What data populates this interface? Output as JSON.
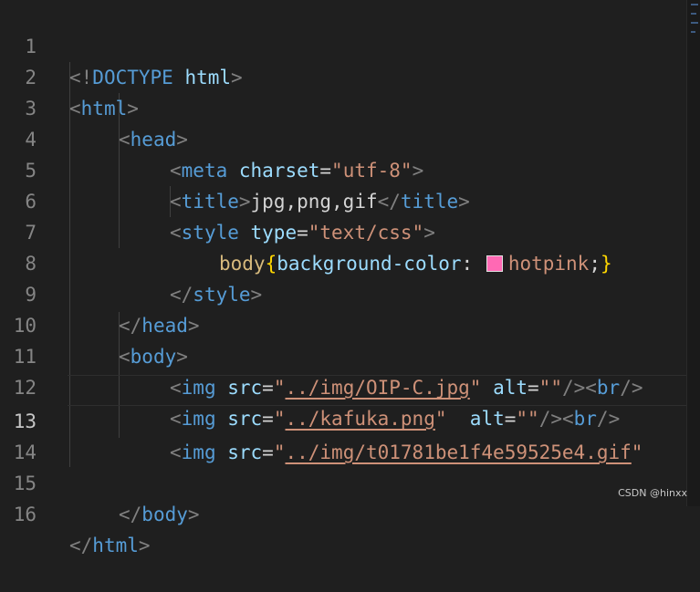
{
  "editor": {
    "lines": [
      {
        "num": "1"
      },
      {
        "num": "2"
      },
      {
        "num": "3"
      },
      {
        "num": "4"
      },
      {
        "num": "5"
      },
      {
        "num": "6"
      },
      {
        "num": "7",
        "swatch_color": "#ff69b4"
      },
      {
        "num": "8"
      },
      {
        "num": "9"
      },
      {
        "num": "10"
      },
      {
        "num": "11"
      },
      {
        "num": "12"
      },
      {
        "num": "13"
      },
      {
        "num": "14"
      },
      {
        "num": "15"
      },
      {
        "num": "16"
      }
    ],
    "active_line": "13",
    "tokens": {
      "l1_open": "<!",
      "l1_tag": "DOCTYPE",
      "l1_attr": " html",
      "l1_close": ">",
      "l2_open": "<",
      "l2_tag": "html",
      "l2_close": ">",
      "l3_open": "<",
      "l3_tag": "head",
      "l3_close": ">",
      "l4_open": "<",
      "l4_tag": "meta",
      "l4_attr": " charset",
      "l4_eq": "=",
      "l4_str": "\"utf-8\"",
      "l4_close": ">",
      "l5_open": "<",
      "l5_tag": "title",
      "l5_close": ">",
      "l5_text": "jpg,png,gif",
      "l5_open2": "</",
      "l5_tag2": "title",
      "l5_close2": ">",
      "l6_open": "<",
      "l6_tag": "style",
      "l6_attr": " type",
      "l6_eq": "=",
      "l6_str": "\"text/css\"",
      "l6_close": ">",
      "l7_sel": "body",
      "l7_brace_open": "{",
      "l7_prop": "background-color",
      "l7_colon": ": ",
      "l7_value": "hotpink",
      "l7_semi": ";",
      "l7_brace_close": "}",
      "l8_open": "</",
      "l8_tag": "style",
      "l8_close": ">",
      "l9_open": "</",
      "l9_tag": "head",
      "l9_close": ">",
      "l10_open": "<",
      "l10_tag": "body",
      "l10_close": ">",
      "l11_open": "<",
      "l11_tag": "img",
      "l11_attr": " src",
      "l11_eq": "=",
      "l11_q1": "\"",
      "l11_link": "../img/OIP-C.jpg",
      "l11_q2": "\"",
      "l11_attr2": " alt",
      "l11_eq2": "=",
      "l11_str2": "\"\"",
      "l11_close": "/><",
      "l11_tag2": "br",
      "l11_close2": "/>",
      "l12_open": "<",
      "l12_tag": "img",
      "l12_attr": " src",
      "l12_eq": "=",
      "l12_q1": "\"",
      "l12_link": "../kafuka.png",
      "l12_q2": "\"",
      "l12_attr2": "  alt",
      "l12_eq2": "=",
      "l12_str2": "\"\"",
      "l12_close": "/><",
      "l12_tag2": "br",
      "l12_close2": "/>",
      "l13_open": "<",
      "l13_tag": "img",
      "l13_attr": " src",
      "l13_eq": "=",
      "l13_q1": "\"",
      "l13_link": "../img/t01781be1f4e59525e4.gif",
      "l13_q2": "\"",
      "l15_open": "</",
      "l15_tag": "body",
      "l15_close": ">",
      "l16_open": "</",
      "l16_tag": "html",
      "l16_close": ">"
    }
  },
  "watermark": "CSDN @hinxx"
}
